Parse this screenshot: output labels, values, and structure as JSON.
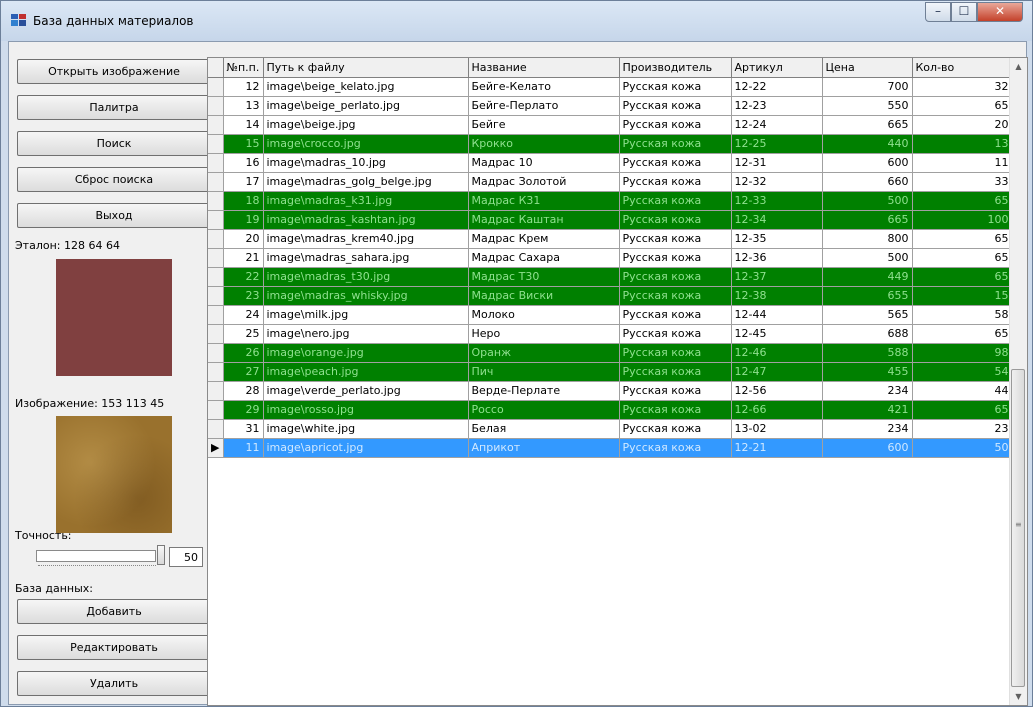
{
  "window": {
    "title": "База данных материалов",
    "accent": "#c4412a"
  },
  "buttons": {
    "open_image": "Открыть изображение",
    "palette": "Палитра",
    "search": "Поиск",
    "reset_search": "Сброс поиска",
    "exit": "Выход",
    "add": "Добавить",
    "edit": "Редактировать",
    "delete": "Удалить"
  },
  "reference": {
    "label": "Эталон: 128 64 64",
    "color": "#804040"
  },
  "image": {
    "label": "Изображение: 153 113 45",
    "color": "#99712d"
  },
  "accuracy": {
    "label": "Точность:",
    "value": "50"
  },
  "database_label": "База данных:",
  "colors": {
    "match_row": "#008000",
    "match_text": "#8fe08f",
    "selected_row": "#3399ff"
  },
  "columns": [
    "№п.п.",
    "Путь к файлу",
    "Название",
    "Производитель",
    "Артикул",
    "Цена",
    "Кол-во"
  ],
  "rows": [
    {
      "n": "12",
      "path": "image\\beige_kelato.jpg",
      "name": "Бейге-Келато",
      "maker": "Русская кожа",
      "art": "12-22",
      "price": "700",
      "qty": "32",
      "state": "normal"
    },
    {
      "n": "13",
      "path": "image\\beige_perlato.jpg",
      "name": "Бейге-Перлато",
      "maker": "Русская кожа",
      "art": "12-23",
      "price": "550",
      "qty": "65",
      "state": "normal"
    },
    {
      "n": "14",
      "path": "image\\beige.jpg",
      "name": "Бейге",
      "maker": "Русская кожа",
      "art": "12-24",
      "price": "665",
      "qty": "20",
      "state": "normal"
    },
    {
      "n": "15",
      "path": "image\\crocco.jpg",
      "name": "Крокко",
      "maker": "Русская кожа",
      "art": "12-25",
      "price": "440",
      "qty": "13",
      "state": "match"
    },
    {
      "n": "16",
      "path": "image\\madras_10.jpg",
      "name": "Мадрас 10",
      "maker": "Русская кожа",
      "art": "12-31",
      "price": "600",
      "qty": "11",
      "state": "normal"
    },
    {
      "n": "17",
      "path": "image\\madras_golg_belge.jpg",
      "name": "Мадрас Золотой",
      "maker": "Русская кожа",
      "art": "12-32",
      "price": "660",
      "qty": "33",
      "state": "normal"
    },
    {
      "n": "18",
      "path": "image\\madras_k31.jpg",
      "name": "Мадрас К31",
      "maker": "Русская кожа",
      "art": "12-33",
      "price": "500",
      "qty": "65",
      "state": "match"
    },
    {
      "n": "19",
      "path": "image\\madras_kashtan.jpg",
      "name": "Мадрас Каштан",
      "maker": "Русская кожа",
      "art": "12-34",
      "price": "665",
      "qty": "100",
      "state": "match"
    },
    {
      "n": "20",
      "path": "image\\madras_krem40.jpg",
      "name": "Мадрас Крем",
      "maker": "Русская кожа",
      "art": "12-35",
      "price": "800",
      "qty": "65",
      "state": "normal"
    },
    {
      "n": "21",
      "path": "image\\madras_sahara.jpg",
      "name": "Мадрас Сахара",
      "maker": "Русская кожа",
      "art": "12-36",
      "price": "500",
      "qty": "65",
      "state": "normal"
    },
    {
      "n": "22",
      "path": "image\\madras_t30.jpg",
      "name": "Мадрас Т30",
      "maker": "Русская кожа",
      "art": "12-37",
      "price": "449",
      "qty": "65",
      "state": "match"
    },
    {
      "n": "23",
      "path": "image\\madras_whisky.jpg",
      "name": "Мадрас Виски",
      "maker": "Русская кожа",
      "art": "12-38",
      "price": "655",
      "qty": "15",
      "state": "match"
    },
    {
      "n": "24",
      "path": "image\\milk.jpg",
      "name": "Молоко",
      "maker": "Русская кожа",
      "art": "12-44",
      "price": "565",
      "qty": "58",
      "state": "normal"
    },
    {
      "n": "25",
      "path": "image\\nero.jpg",
      "name": "Неро",
      "maker": "Русская кожа",
      "art": "12-45",
      "price": "688",
      "qty": "65",
      "state": "normal"
    },
    {
      "n": "26",
      "path": "image\\orange.jpg",
      "name": "Оранж",
      "maker": "Русская кожа",
      "art": "12-46",
      "price": "588",
      "qty": "98",
      "state": "match"
    },
    {
      "n": "27",
      "path": "image\\peach.jpg",
      "name": "Пич",
      "maker": "Русская кожа",
      "art": "12-47",
      "price": "455",
      "qty": "54",
      "state": "match"
    },
    {
      "n": "28",
      "path": "image\\verde_perlato.jpg",
      "name": "Верде-Перлате",
      "maker": "Русская кожа",
      "art": "12-56",
      "price": "234",
      "qty": "44",
      "state": "normal"
    },
    {
      "n": "29",
      "path": "image\\rosso.jpg",
      "name": "Россо",
      "maker": "Русская кожа",
      "art": "12-66",
      "price": "421",
      "qty": "65",
      "state": "match"
    },
    {
      "n": "31",
      "path": "image\\white.jpg",
      "name": "Белая",
      "maker": "Русская кожа",
      "art": "13-02",
      "price": "234",
      "qty": "23",
      "state": "normal"
    },
    {
      "n": "11",
      "path": "image\\apricot.jpg",
      "name": "Априкот",
      "maker": "Русская кожа",
      "art": "12-21",
      "price": "600",
      "qty": "50",
      "state": "selected"
    }
  ]
}
